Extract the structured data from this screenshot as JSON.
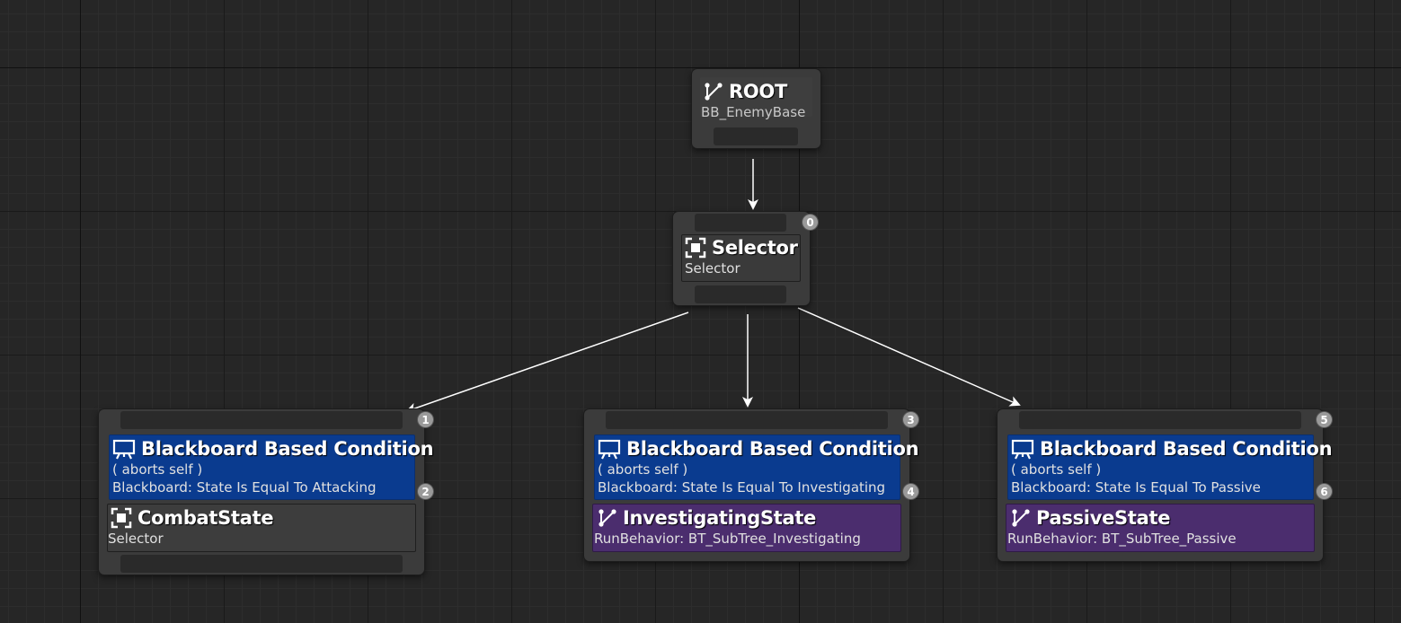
{
  "root": {
    "title": "ROOT",
    "subtitle": "BB_EnemyBase"
  },
  "selector": {
    "title": "Selector",
    "subtitle": "Selector",
    "index": "0"
  },
  "branches": [
    {
      "decorator": {
        "title": "Blackboard Based Condition",
        "aborts": "( aborts self )",
        "condition": "Blackboard: State Is Equal To Attacking",
        "index": "1",
        "sub_index": "2"
      },
      "task": {
        "title": "CombatState",
        "subtitle": "Selector",
        "kind": "selector-icon"
      }
    },
    {
      "decorator": {
        "title": "Blackboard Based Condition",
        "aborts": "( aborts self )",
        "condition": "Blackboard: State Is Equal To Investigating",
        "index": "3",
        "sub_index": "4"
      },
      "task": {
        "title": "InvestigatingState",
        "subtitle": "RunBehavior: BT_SubTree_Investigating",
        "kind": "run-behavior-icon"
      }
    },
    {
      "decorator": {
        "title": "Blackboard Based Condition",
        "aborts": "( aborts self )",
        "condition": "Blackboard: State Is Equal To Passive",
        "index": "5",
        "sub_index": "6"
      },
      "task": {
        "title": "PassiveState",
        "subtitle": "RunBehavior: BT_SubTree_Passive",
        "kind": "run-behavior-icon"
      }
    }
  ],
  "colors": {
    "decorator": "#0a3b8f",
    "subtree_task": "#4b2d6e",
    "node_body": "#3b3b3b",
    "wire": "#ffffff",
    "badge": "#9a9a9a"
  }
}
